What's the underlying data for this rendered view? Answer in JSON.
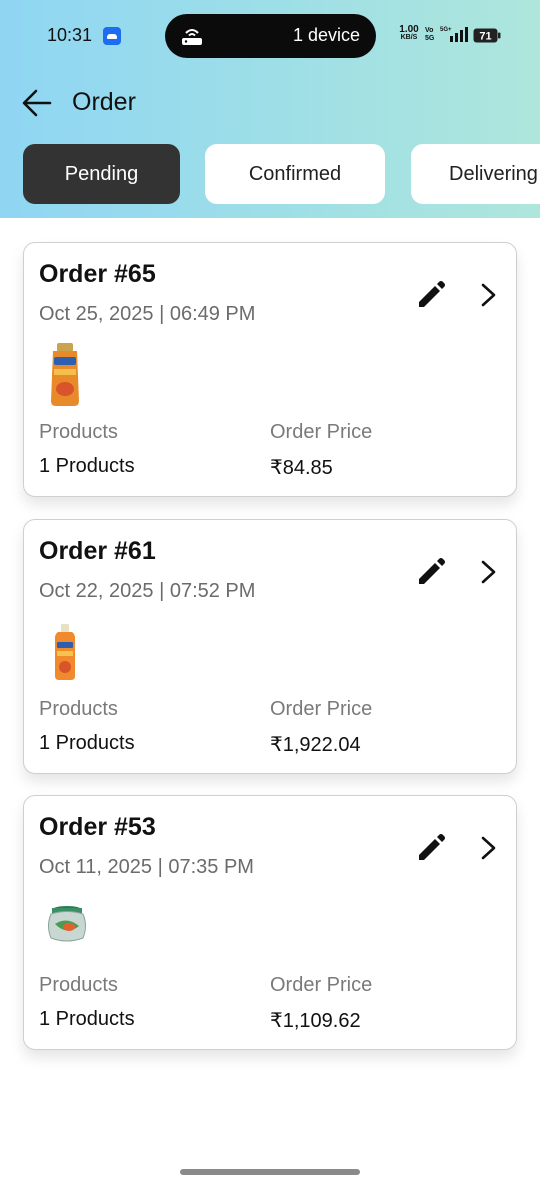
{
  "status_bar": {
    "time": "10:31",
    "island_text": "1 device",
    "net_speed": "1.00",
    "net_unit": "KB/S",
    "volte_top": "Vo",
    "volte_bottom": "5G",
    "network": "5G+",
    "battery": "71"
  },
  "header": {
    "title": "Order"
  },
  "tabs": [
    {
      "label": "Pending",
      "active": true
    },
    {
      "label": "Confirmed",
      "active": false
    },
    {
      "label": "Delivering",
      "active": false
    }
  ],
  "orders": [
    {
      "title": "Order #65",
      "date": "Oct 25, 2025 | 06:49 PM",
      "products_label": "Products",
      "products_value": "1 Products",
      "price_label": "Order Price",
      "price_value": "₹84.85",
      "thumb": "face-wash-tube"
    },
    {
      "title": "Order #61",
      "date": "Oct 22, 2025 | 07:52 PM",
      "products_label": "Products",
      "products_value": "1 Products",
      "price_label": "Order Price",
      "price_value": "₹1,922.04",
      "thumb": "face-wash-bottle"
    },
    {
      "title": "Order #53",
      "date": "Oct 11, 2025 | 07:35 PM",
      "products_label": "Products",
      "products_value": "1 Products",
      "price_label": "Order Price",
      "price_value": "₹1,109.62",
      "thumb": "glass-jar"
    }
  ],
  "colors": {
    "header_gradient_start": "#8fd6f3",
    "header_gradient_end": "#aee6dc",
    "active_tab": "#333333",
    "inactive_tab": "#ffffff"
  }
}
